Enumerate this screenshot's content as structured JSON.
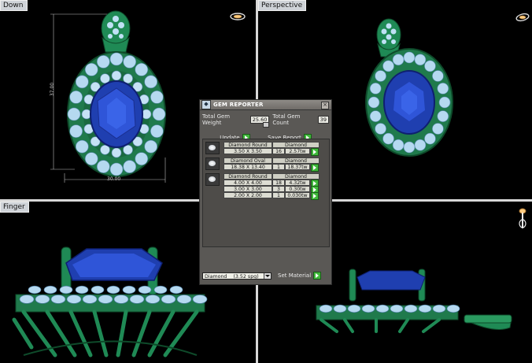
{
  "viewports": {
    "top_left": "Down",
    "top_right": "Perspective",
    "bottom_left": "Finger",
    "bottom_right": ""
  },
  "dimensions": {
    "height": "37.00",
    "width": "30.00"
  },
  "gem_reporter": {
    "title": "GEM REPORTER",
    "total_weight_label": "Total Gem Weight",
    "total_weight": "25.60",
    "total_count_label": "Total Gem Count",
    "total_count": "39",
    "update_label": "Update",
    "save_label": "Save Report",
    "groups": [
      {
        "name": "Diamond Round",
        "material": "Diamond",
        "rows": [
          {
            "size": "3.50 X 3.50",
            "count": "16",
            "weight": "2.57tw"
          }
        ]
      },
      {
        "name": "Diamond Oval",
        "material": "Diamond",
        "rows": [
          {
            "size": "18.38 X 13.40",
            "count": "1",
            "weight": "18.37tw"
          }
        ]
      },
      {
        "name": "Diamond Round",
        "material": "Diamond",
        "rows": [
          {
            "size": "4.00 X 4.00",
            "count": "18",
            "weight": "4.32tw"
          },
          {
            "size": "3.00 X 3.00",
            "count": "3",
            "weight": "0.30tw"
          },
          {
            "size": "2.00 X 2.00",
            "count": "1",
            "weight": "0.030tw"
          }
        ]
      }
    ],
    "material_select": "Diamond",
    "material_sg": "(3.52 spg)",
    "set_material_label": "Set Material"
  },
  "colors": {
    "metal": "#1f7a4c",
    "sapphire": "#1f3fb0",
    "diamond": "#b9dcf2",
    "panel": "#5a5855"
  }
}
